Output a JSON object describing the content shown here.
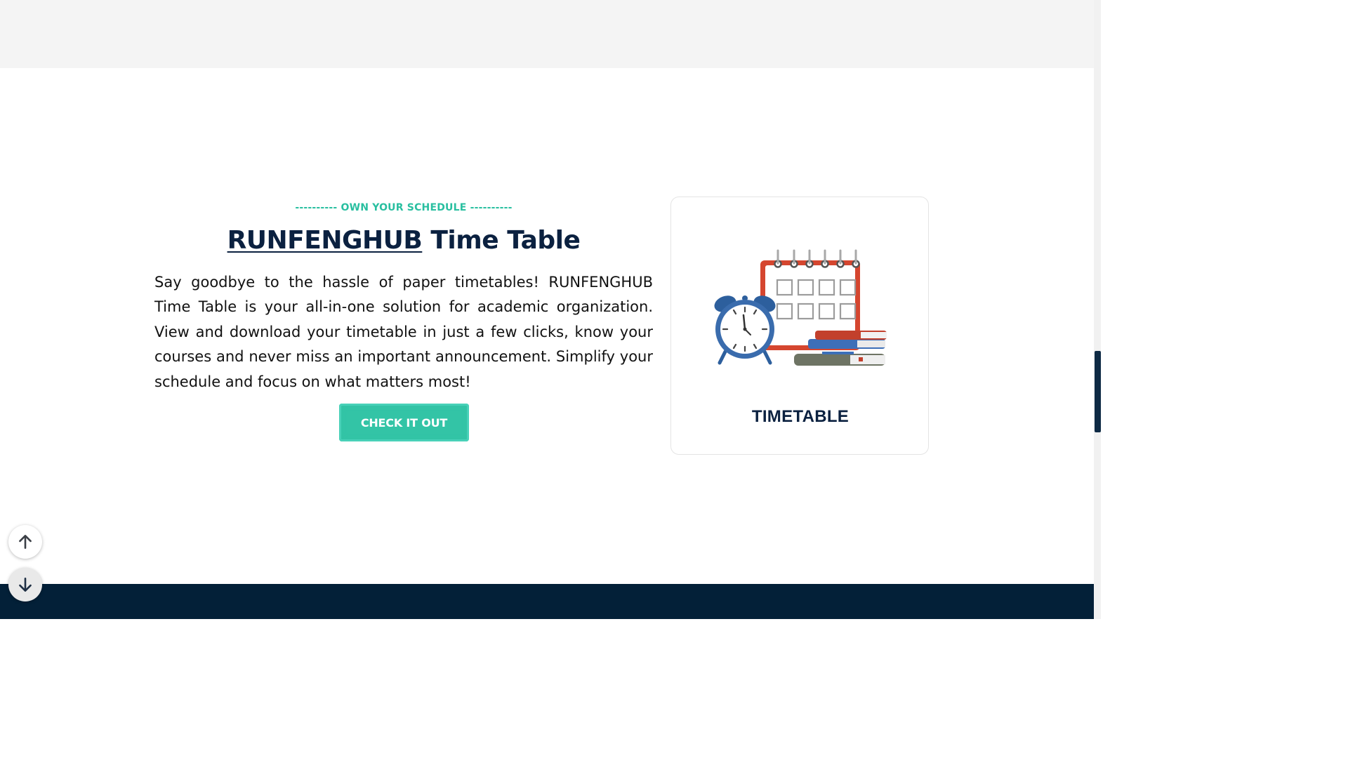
{
  "section": {
    "eyebrow": "---------- OWN YOUR SCHEDULE ----------",
    "title_brand": "RUNFENGHUB",
    "title_rest": " Time Table",
    "description": "Say goodbye to the hassle of paper timetables! RUNFENGHUB Time Table is your all-in-one solution for academic organization. View and download your timetable in just a few clicks, know your courses and never miss an important announcement. Simplify your schedule and focus on what matters most!",
    "cta_label": "CHECK IT OUT"
  },
  "card": {
    "label": "TIMETABLE",
    "illustration_icon": "calendar-clock-books-icon"
  },
  "scroll_controls": {
    "up_icon": "arrow-up-icon",
    "down_icon": "arrow-down-icon"
  },
  "colors": {
    "accent": "#33c4a6",
    "eyebrow": "#29bfa0",
    "heading": "#0b2140",
    "footer": "#032038",
    "top_band": "#f4f4f4"
  }
}
